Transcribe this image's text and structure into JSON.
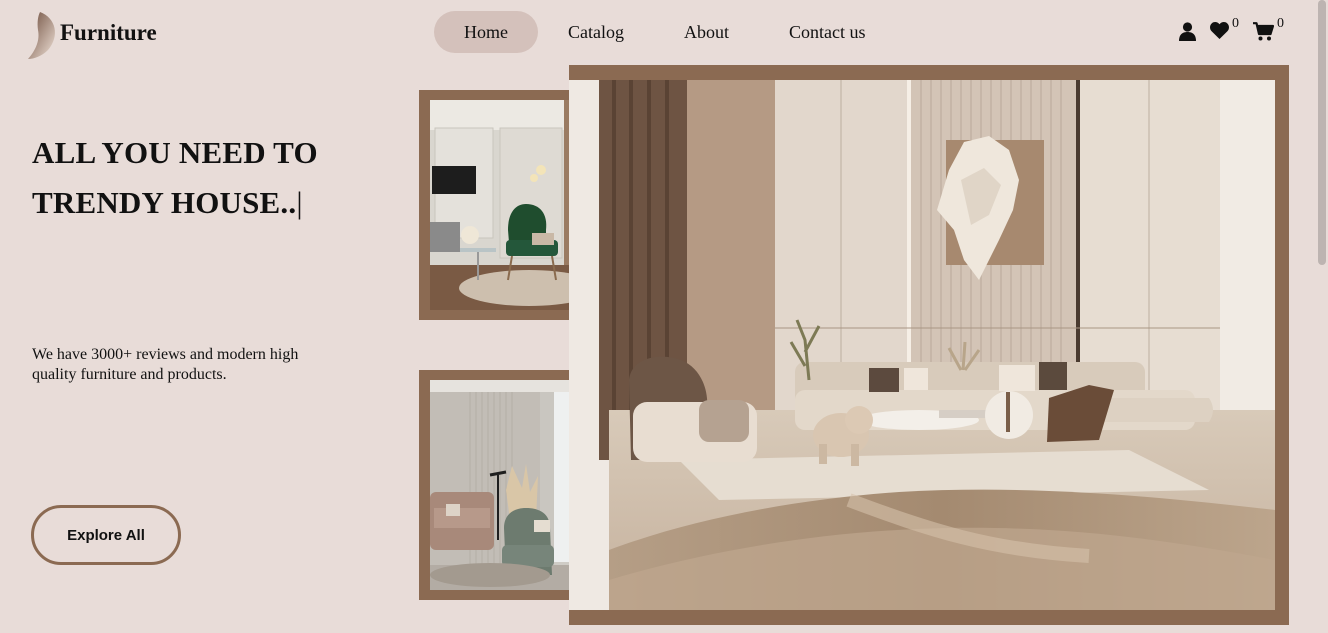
{
  "brand": {
    "name": "Furniture"
  },
  "nav": {
    "items": [
      {
        "label": "Home"
      },
      {
        "label": "Catalog"
      },
      {
        "label": "About"
      },
      {
        "label": "Contact us"
      }
    ]
  },
  "header": {
    "wishlist_count": "0",
    "cart_count": "0"
  },
  "hero": {
    "headline_line1": "ALL YOU NEED TO",
    "headline_line2": "TRENDY HOUSE..",
    "caret": "|",
    "description": "We have 3000+ reviews and modern high quality furniture and products.",
    "cta_label": "Explore All"
  },
  "colors": {
    "background": "#e8dcd8",
    "nav_active": "#d4c1bb",
    "frame_brown": "#8b6a52"
  }
}
